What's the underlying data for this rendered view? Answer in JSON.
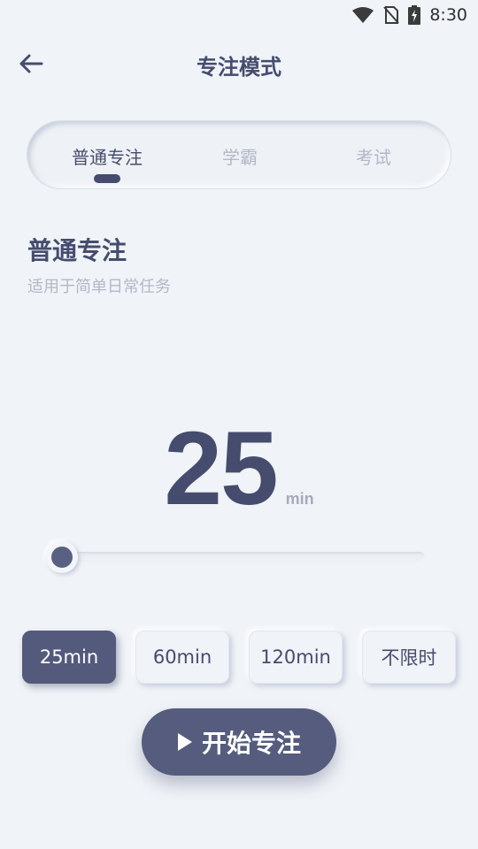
{
  "status_bar": {
    "time": "8:30"
  },
  "header": {
    "title": "专注模式"
  },
  "tabs": [
    {
      "label": "普通专注",
      "active": true
    },
    {
      "label": "学霸",
      "active": false
    },
    {
      "label": "考试",
      "active": false
    }
  ],
  "mode": {
    "title": "普通专注",
    "description": "适用于简单日常任务"
  },
  "timer": {
    "value": "25",
    "unit": "min"
  },
  "slider": {
    "level": 0.0
  },
  "presets": [
    {
      "label": "25min",
      "selected": true
    },
    {
      "label": "60min",
      "selected": false
    },
    {
      "label": "120min",
      "selected": false
    },
    {
      "label": "不限时",
      "selected": false
    }
  ],
  "start_button": {
    "label": "开始专注"
  },
  "colors": {
    "accent": "#535a7c",
    "text": "#454c6e",
    "muted": "#b3b8c8",
    "background": "#f0f3f7"
  }
}
